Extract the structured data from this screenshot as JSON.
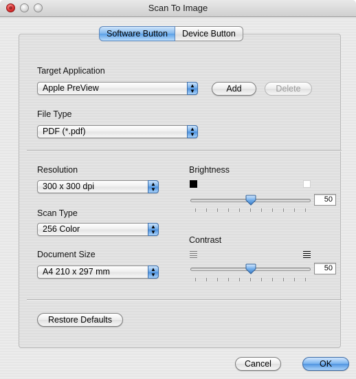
{
  "window": {
    "title": "Scan To Image"
  },
  "tabs": [
    {
      "label": "Software Button",
      "active": true
    },
    {
      "label": "Device Button",
      "active": false
    }
  ],
  "target_application": {
    "label": "Target Application",
    "value": "Apple PreView",
    "add_label": "Add",
    "delete_label": "Delete"
  },
  "file_type": {
    "label": "File Type",
    "value": "PDF (*.pdf)"
  },
  "resolution": {
    "label": "Resolution",
    "value": "300 x 300 dpi"
  },
  "scan_type": {
    "label": "Scan Type",
    "value": "256 Color"
  },
  "document_size": {
    "label": "Document Size",
    "value": "A4 210 x 297 mm"
  },
  "brightness": {
    "label": "Brightness",
    "value": "50",
    "fraction": 0.5
  },
  "contrast": {
    "label": "Contrast",
    "value": "50",
    "fraction": 0.5
  },
  "buttons": {
    "restore_defaults": "Restore Defaults",
    "cancel": "Cancel",
    "ok": "OK"
  },
  "colors": {
    "accent_blue": "#5aa0e7",
    "panel_bg": "#e4e4e4",
    "window_bg": "#ececec"
  },
  "icons": {
    "brightness_low": "black-square-icon",
    "brightness_high": "white-square-icon",
    "contrast_low": "low-contrast-lines-icon",
    "contrast_high": "high-contrast-lines-icon"
  }
}
